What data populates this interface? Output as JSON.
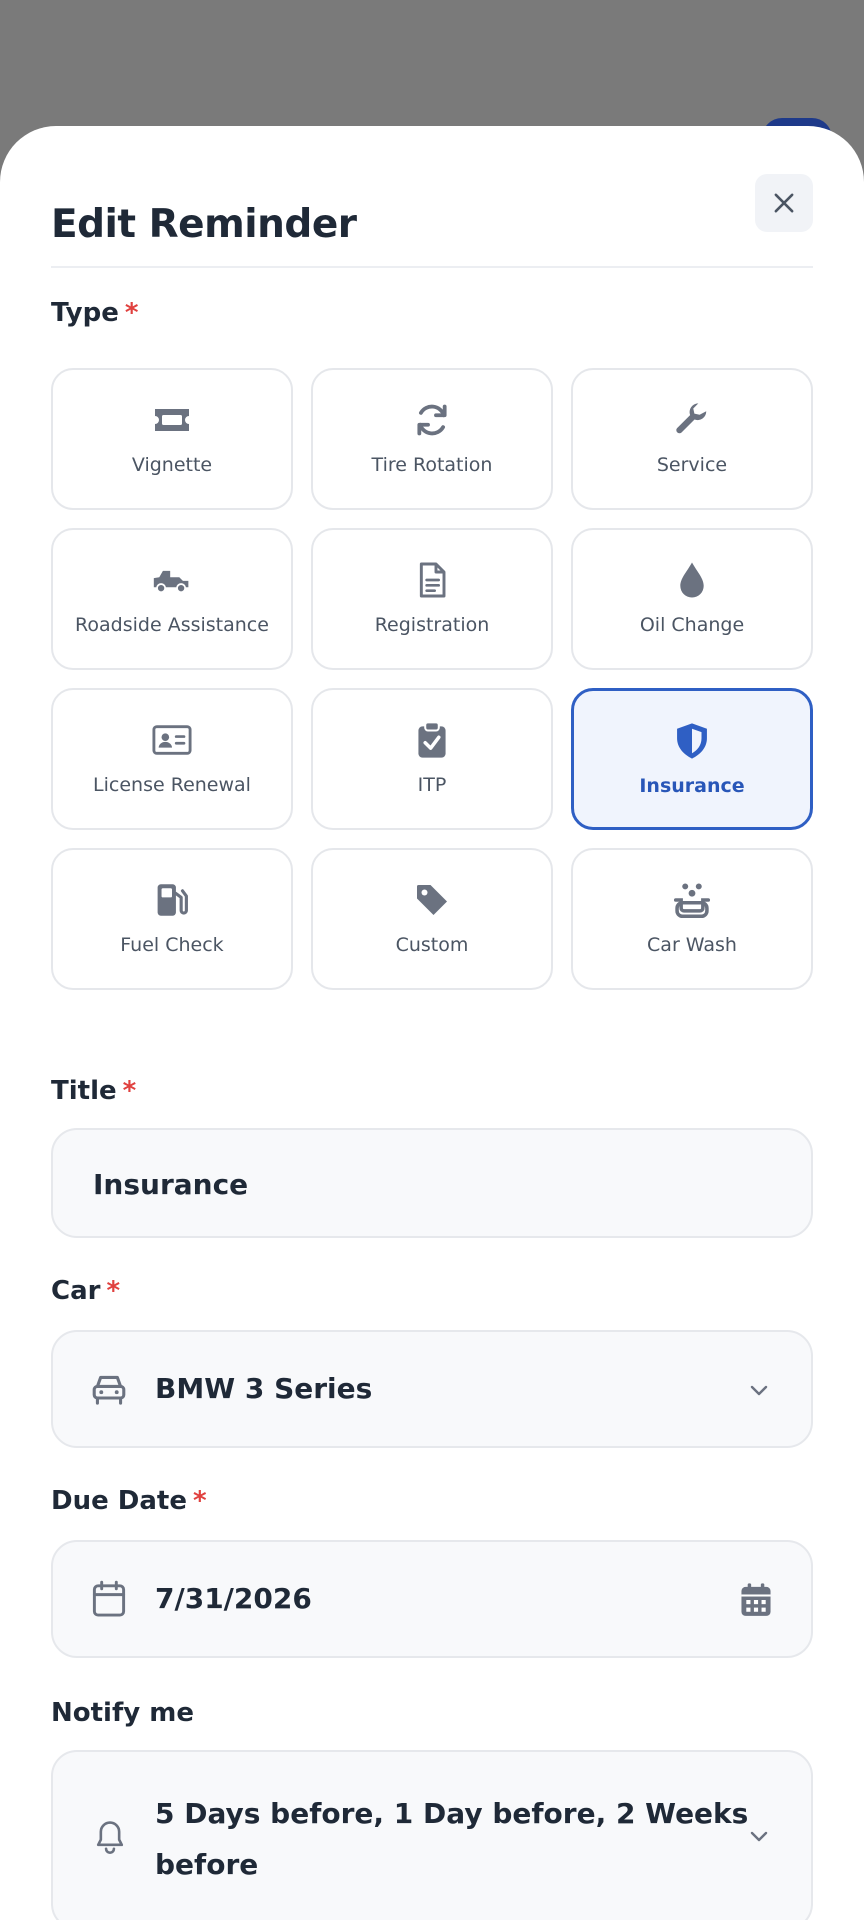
{
  "header": {
    "title": "Edit Reminder"
  },
  "type_section": {
    "label": "Type",
    "required_mark": "*",
    "items": [
      {
        "label": "Vignette",
        "icon": "ticket-icon"
      },
      {
        "label": "Tire Rotation",
        "icon": "rotate-icon"
      },
      {
        "label": "Service",
        "icon": "wrench-icon"
      },
      {
        "label": "Roadside Assistance",
        "icon": "tow-truck-icon"
      },
      {
        "label": "Registration",
        "icon": "document-icon"
      },
      {
        "label": "Oil Change",
        "icon": "oil-drop-icon"
      },
      {
        "label": "License Renewal",
        "icon": "id-card-icon"
      },
      {
        "label": "ITP",
        "icon": "clipboard-check-icon"
      },
      {
        "label": "Insurance",
        "icon": "shield-icon",
        "selected": true
      },
      {
        "label": "Fuel Check",
        "icon": "fuel-pump-icon"
      },
      {
        "label": "Custom",
        "icon": "tag-icon"
      },
      {
        "label": "Car Wash",
        "icon": "car-wash-icon"
      }
    ]
  },
  "title_field": {
    "label": "Title",
    "required_mark": "*",
    "value": "Insurance"
  },
  "car_field": {
    "label": "Car",
    "required_mark": "*",
    "value": "BMW 3 Series"
  },
  "due_date_field": {
    "label": "Due Date",
    "required_mark": "*",
    "value": "7/31/2026"
  },
  "notify_field": {
    "label": "Notify me",
    "value_line1": "5 Days before, 1 Day before, 2 Weeks",
    "value_line2": "before"
  },
  "colors": {
    "accent": "#2f5fc4",
    "required": "#e0413f",
    "icon_gray": "#6b7280"
  }
}
